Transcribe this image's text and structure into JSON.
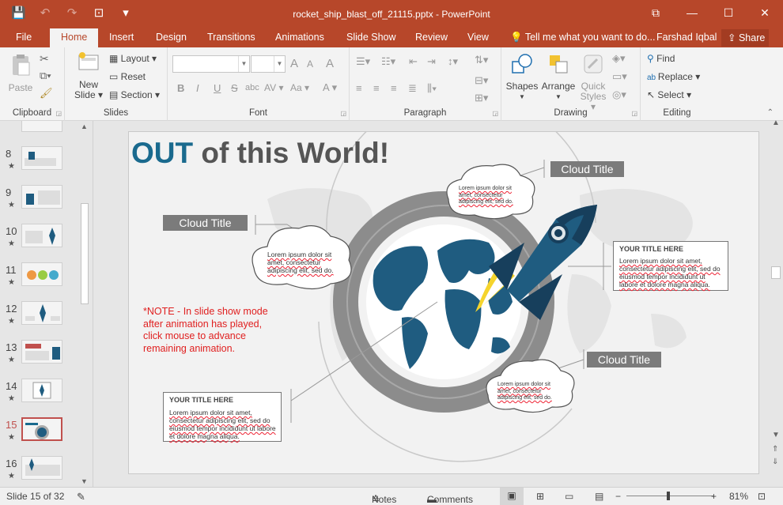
{
  "window": {
    "title": "rocket_ship_blast_off_21115.pptx - PowerPoint",
    "controls": {
      "restore_ribbon": "⧉",
      "minimize": "—",
      "maximize": "☐",
      "close": "✕"
    }
  },
  "qat": {
    "save": "💾",
    "undo": "↶",
    "redo": "↷",
    "start_from_beginning": "⊡",
    "customize": "▾"
  },
  "tabs": [
    "File",
    "Home",
    "Insert",
    "Design",
    "Transitions",
    "Animations",
    "Slide Show",
    "Review",
    "View"
  ],
  "active_tab": "Home",
  "tell_me": "Tell me what you want to do...",
  "user": "Farshad Iqbal",
  "share": "Share",
  "ribbon": {
    "clipboard": {
      "label": "Clipboard",
      "paste": "Paste"
    },
    "slides": {
      "label": "Slides",
      "new_slide_1": "New",
      "new_slide_2": "Slide ▾",
      "layout": "Layout ▾",
      "reset": "Reset",
      "section": "Section ▾"
    },
    "font": {
      "label": "Font",
      "font_name": "",
      "font_size": "",
      "bold": "B",
      "italic": "I",
      "underline": "U",
      "strike": "S",
      "shadow": "abc",
      "spacing": "AV ▾",
      "case": "Aa ▾",
      "color": "A ▾",
      "grow": "A",
      "shrink": "A",
      "clear": "A"
    },
    "paragraph": {
      "label": "Paragraph"
    },
    "drawing": {
      "label": "Drawing",
      "shapes": "Shapes",
      "arrange": "Arrange",
      "quick_styles_1": "Quick",
      "quick_styles_2": "Styles ▾"
    },
    "editing": {
      "label": "Editing",
      "find": "Find",
      "replace": "Replace ▾",
      "select": "Select ▾"
    }
  },
  "thumbnails": [
    {
      "num": "8",
      "star": "★"
    },
    {
      "num": "9",
      "star": "★"
    },
    {
      "num": "10",
      "star": "★"
    },
    {
      "num": "11",
      "star": "★"
    },
    {
      "num": "12",
      "star": "★"
    },
    {
      "num": "13",
      "star": "★"
    },
    {
      "num": "14",
      "star": "★"
    },
    {
      "num": "15",
      "star": "★"
    },
    {
      "num": "16",
      "star": "★"
    }
  ],
  "selected_slide": "15",
  "slide": {
    "title_accent": "OUT",
    "title_rest": " of this World!",
    "cloud_titles": [
      "Cloud Title",
      "Cloud Title",
      "Cloud Title"
    ],
    "cloud_texts": [
      "Lorem ipsum dolor sit amet, consectetur adipiscing elit, sed do.",
      "Lorem ipsum dolor sit amet, consectetur adipiscing elit, sed do.",
      "Lorem ipsum dolor sit amet, consectetur adipiscing elit, sed do."
    ],
    "box_titles": [
      "YOUR TITLE HERE",
      "YOUR TITLE HERE"
    ],
    "box_texts": [
      "Lorem ipsum dolor sit amet, consectetur adipiscing elit, sed do eiusmod tempor incididunt ut labore et dolore magna aliqua.",
      "Lorem ipsum dolor sit amet, consectetur adipiscing elit, sed do eiusmod tempor incididunt ut labore et dolore magna aliqua."
    ],
    "note": "*NOTE - In slide show mode after animation has played, click mouse to advance remaining animation."
  },
  "status": {
    "slide_info": "Slide 15 of 32",
    "notes": "Notes",
    "comments": "Comments",
    "zoom": "81%",
    "zoom_minus": "−",
    "zoom_plus": "+"
  },
  "colors": {
    "accent": "#b7472a",
    "title_blue": "#1a6a8e",
    "note_red": "#e02020",
    "rocket_blue": "#1f5c80"
  }
}
